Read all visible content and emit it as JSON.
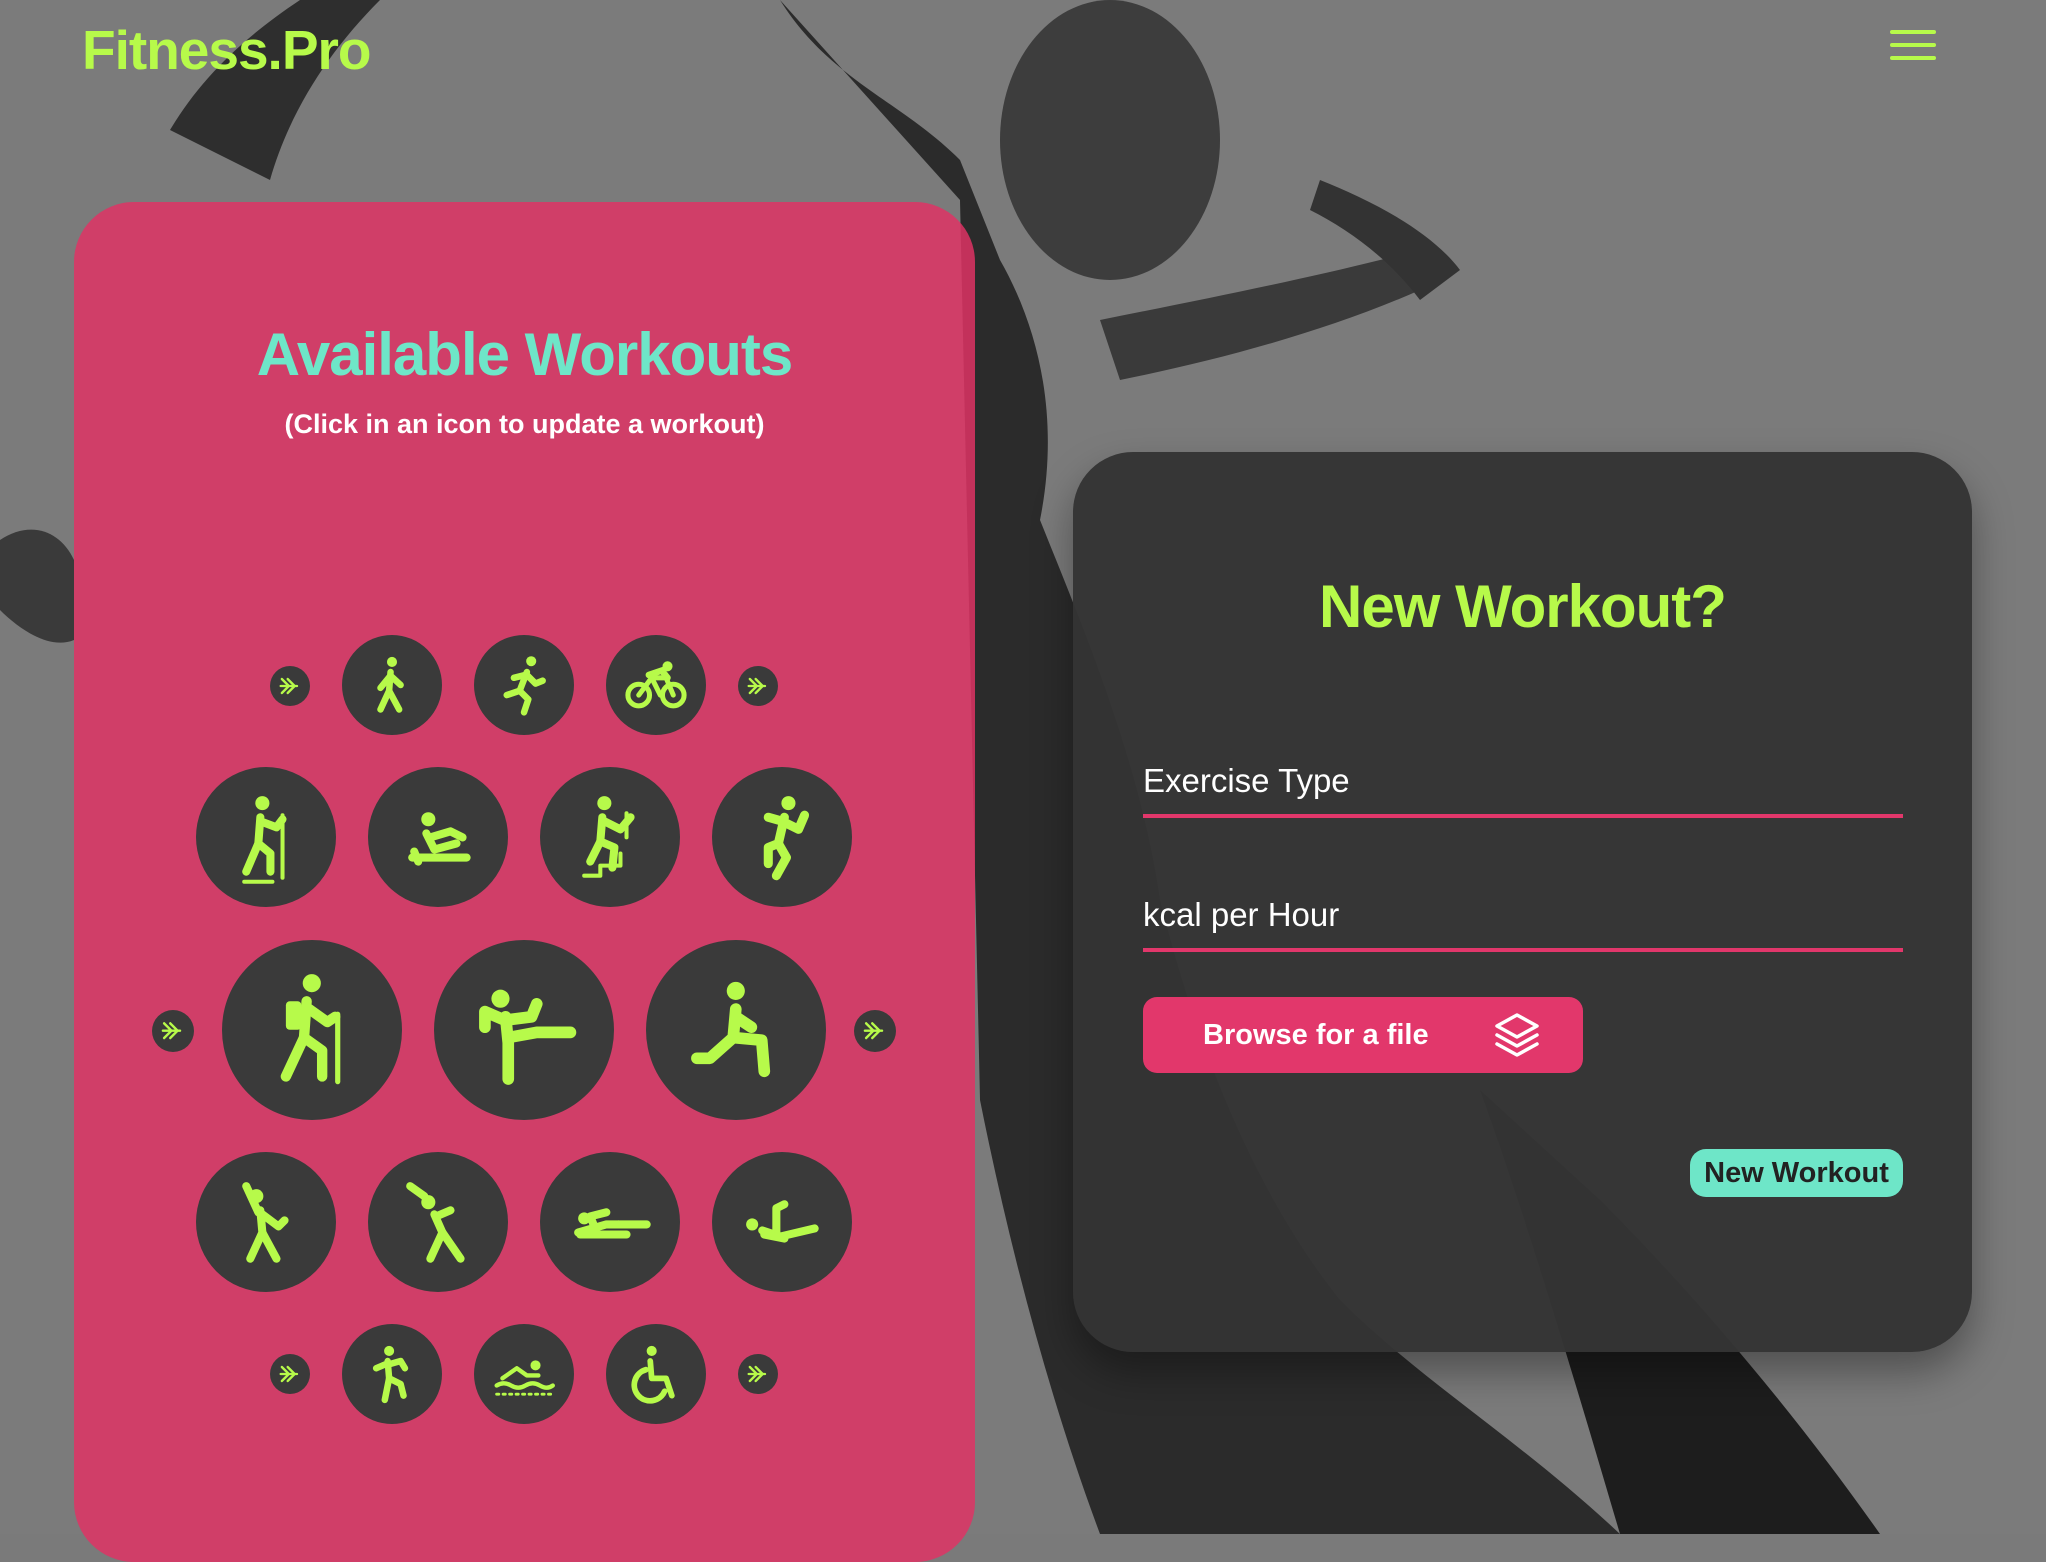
{
  "brand": {
    "name": "Fitness.Pro"
  },
  "header": {
    "menu_icon": "hamburger-menu-icon"
  },
  "colors": {
    "accent_green": "#b7fa4a",
    "accent_teal": "#6ee6c8",
    "accent_pink": "#e2376b",
    "panel_dark": "#343434",
    "icon_bg": "#3a3a3a"
  },
  "workouts_panel": {
    "title": "Available Workouts",
    "subtitle": "(Click in an icon to update a workout)",
    "rows": [
      {
        "icons": [
          "walking-icon",
          "running-icon",
          "cycling-icon"
        ],
        "arrows": true
      },
      {
        "icons": [
          "nordic-walking-icon",
          "rowing-icon",
          "stair-climbing-icon",
          "dance-icon"
        ],
        "arrows": false
      },
      {
        "icons": [
          "hiking-icon",
          "martial-arts-icon",
          "stretching-icon"
        ],
        "arrows": true
      },
      {
        "icons": [
          "aerobics-icon",
          "yoga-icon",
          "floor-exercise-icon",
          "pilates-icon"
        ],
        "arrows": false
      },
      {
        "icons": [
          "kickboxing-icon",
          "swimming-icon",
          "wheelchair-icon"
        ],
        "arrows": true
      }
    ]
  },
  "new_workout": {
    "title": "New Workout?",
    "exercise_type_placeholder": "Exercise Type",
    "kcal_placeholder": "kcal per Hour",
    "browse_label": "Browse for a file",
    "browse_icon": "layers-icon",
    "submit_label": "New Workout"
  }
}
